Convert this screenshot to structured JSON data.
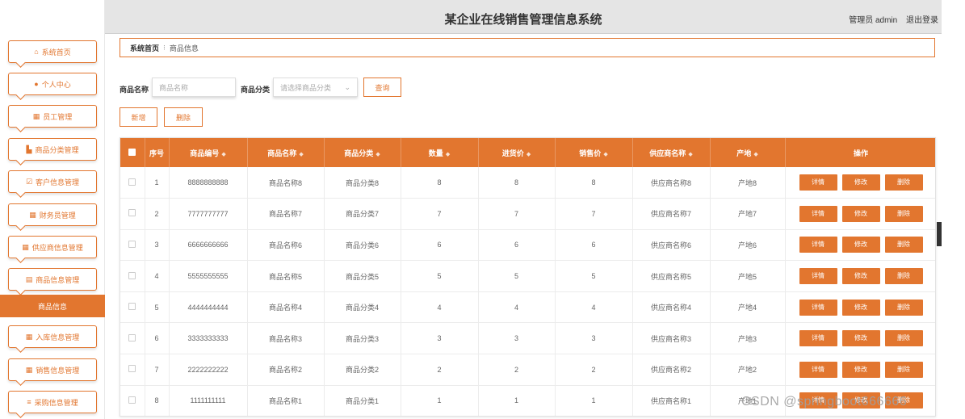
{
  "header": {
    "title": "某企业在线销售管理信息系统",
    "user": "管理员 admin",
    "logout": "退出登录"
  },
  "sidebar": {
    "items": [
      {
        "label": "系统首页",
        "icon": "home-icon",
        "glyph": "⌂"
      },
      {
        "label": "个人中心",
        "icon": "user-icon",
        "glyph": "●"
      },
      {
        "label": "员工管理",
        "icon": "grid-icon",
        "glyph": "▦"
      },
      {
        "label": "商品分类管理",
        "icon": "thumb-icon",
        "glyph": "▙"
      },
      {
        "label": "客户信息管理",
        "icon": "check-icon",
        "glyph": "☑"
      },
      {
        "label": "财务员管理",
        "icon": "grid-icon",
        "glyph": "▦"
      },
      {
        "label": "供应商信息管理",
        "icon": "apps-icon",
        "glyph": "▦"
      },
      {
        "label": "商品信息管理",
        "icon": "clipboard-icon",
        "glyph": "▤"
      },
      {
        "label": "入库信息管理",
        "icon": "grid-icon",
        "glyph": "▦"
      },
      {
        "label": "销售信息管理",
        "icon": "grid-icon",
        "glyph": "▦"
      },
      {
        "label": "采购信息管理",
        "icon": "list-icon",
        "glyph": "≡"
      }
    ],
    "active_sub": "商品信息"
  },
  "breadcrumb": {
    "home": "系统首页",
    "current": "商品信息"
  },
  "search": {
    "name_label": "商品名称",
    "name_placeholder": "商品名称",
    "category_label": "商品分类",
    "category_placeholder": "请选择商品分类",
    "query_button": "查询"
  },
  "actions": {
    "add": "新增",
    "delete": "删除"
  },
  "table": {
    "columns": [
      "序号",
      "商品编号",
      "商品名称",
      "商品分类",
      "数量",
      "进货价",
      "销售价",
      "供应商名称",
      "产地",
      "操作"
    ],
    "rows": [
      [
        "1",
        "8888888888",
        "商品名称8",
        "商品分类8",
        "8",
        "8",
        "8",
        "供应商名称8",
        "产地8"
      ],
      [
        "2",
        "7777777777",
        "商品名称7",
        "商品分类7",
        "7",
        "7",
        "7",
        "供应商名称7",
        "产地7"
      ],
      [
        "3",
        "6666666666",
        "商品名称6",
        "商品分类6",
        "6",
        "6",
        "6",
        "供应商名称6",
        "产地6"
      ],
      [
        "4",
        "5555555555",
        "商品名称5",
        "商品分类5",
        "5",
        "5",
        "5",
        "供应商名称5",
        "产地5"
      ],
      [
        "5",
        "4444444444",
        "商品名称4",
        "商品分类4",
        "4",
        "4",
        "4",
        "供应商名称4",
        "产地4"
      ],
      [
        "6",
        "3333333333",
        "商品名称3",
        "商品分类3",
        "3",
        "3",
        "3",
        "供应商名称3",
        "产地3"
      ],
      [
        "7",
        "2222222222",
        "商品名称2",
        "商品分类2",
        "2",
        "2",
        "2",
        "供应商名称2",
        "产地2"
      ],
      [
        "8",
        "1111111111",
        "商品名称1",
        "商品分类1",
        "1",
        "1",
        "1",
        "供应商名称1",
        "产地1"
      ]
    ],
    "row_buttons": [
      "详情",
      "修改",
      "删除"
    ]
  },
  "watermark": "CSDN @springboot666666",
  "colors": {
    "accent": "#e2762f",
    "header_bg": "#e5e5e5"
  }
}
